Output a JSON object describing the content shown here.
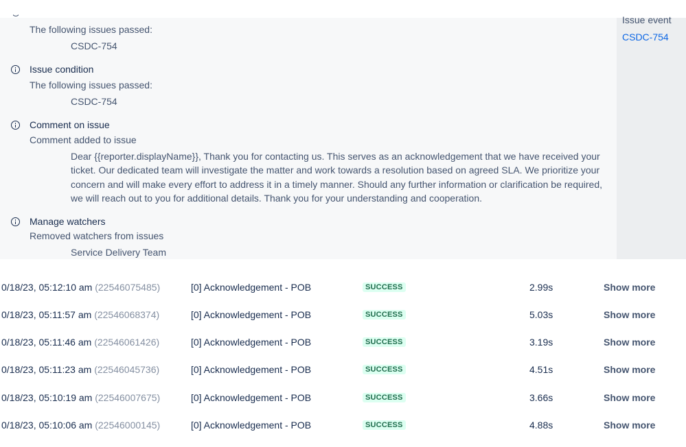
{
  "side": {
    "label": "Issue event",
    "link": "CSDC-754"
  },
  "details": {
    "top_sub": "The following issues passed:",
    "top_value": "CSDC-754",
    "items": [
      {
        "title": "Issue condition",
        "sub": "The following issues passed:",
        "value": "CSDC-754"
      },
      {
        "title": "Comment on issue",
        "sub": "Comment added to issue",
        "value": "Dear {{reporter.displayName}}, Thank you for contacting us. This serves as an acknowledgement that we have received your ticket. Our dedicated team will investigate the matter and work towards a resolution based on agreed SLA. We prioritize your concern and will make every effort to address it in a timely manner. Should any further information or clarification be required, we will reach out to you for additional details. Thank you for your understanding and cooperation."
      },
      {
        "title": "Manage watchers",
        "sub": "Removed watchers from issues",
        "value": "Service Delivery Team"
      }
    ]
  },
  "log": {
    "show_more_label": "Show more",
    "rows": [
      {
        "date": "0/18/23, 05:12:10 am",
        "id": "(22546075485)",
        "rule": "[0] Acknowledgement - POB",
        "status": "SUCCESS",
        "duration": "2.99s"
      },
      {
        "date": "0/18/23, 05:11:57 am",
        "id": "(22546068374)",
        "rule": "[0] Acknowledgement - POB",
        "status": "SUCCESS",
        "duration": "5.03s"
      },
      {
        "date": "0/18/23, 05:11:46 am",
        "id": "(22546061426)",
        "rule": "[0] Acknowledgement - POB",
        "status": "SUCCESS",
        "duration": "3.19s"
      },
      {
        "date": "0/18/23, 05:11:23 am",
        "id": "(22546045736)",
        "rule": "[0] Acknowledgement - POB",
        "status": "SUCCESS",
        "duration": "4.51s"
      },
      {
        "date": "0/18/23, 05:10:19 am",
        "id": "(22546007675)",
        "rule": "[0] Acknowledgement - POB",
        "status": "SUCCESS",
        "duration": "3.66s"
      },
      {
        "date": "0/18/23, 05:10:06 am",
        "id": "(22546000145)",
        "rule": "[0] Acknowledgement - POB",
        "status": "SUCCESS",
        "duration": "4.88s"
      }
    ]
  },
  "colors": {
    "success_bg": "#dcfff1",
    "success_text": "#216e4e",
    "link": "#0c66e4"
  }
}
